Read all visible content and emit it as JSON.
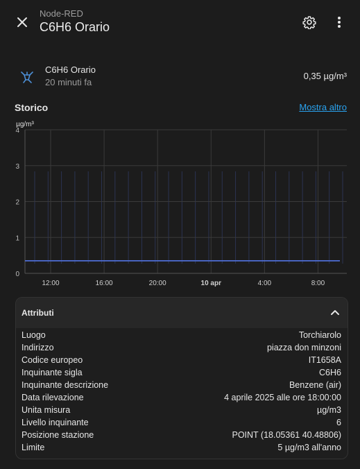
{
  "header": {
    "subtitle": "Node-RED",
    "title": "C6H6 Orario"
  },
  "entity": {
    "name": "C6H6 Orario",
    "last_changed": "20 minuti fa",
    "state": "0,35 µg/m³",
    "icon": "molecule-icon"
  },
  "history": {
    "title": "Storico",
    "show_more": "Mostra altro"
  },
  "chart_data": {
    "type": "line",
    "ylabel": "µg/m³",
    "ylim": [
      0,
      4
    ],
    "y_ticks": [
      "0",
      "1",
      "2",
      "3",
      "4"
    ],
    "x_ticks": [
      "12:00",
      "16:00",
      "20:00",
      "10 apr",
      "4:00",
      "8:00"
    ],
    "x_ticks_bold": [
      false,
      false,
      false,
      true,
      false,
      false
    ],
    "series": [
      {
        "values": [
          0.35,
          0.35
        ]
      }
    ],
    "grid": true,
    "line_color": "#4e6ed6"
  },
  "attributes": {
    "title": "Attributi",
    "items": [
      {
        "key": "Luogo",
        "value": "Torchiarolo"
      },
      {
        "key": "Indirizzo",
        "value": "piazza don minzoni"
      },
      {
        "key": "Codice europeo",
        "value": "IT1658A"
      },
      {
        "key": "Inquinante sigla",
        "value": "C6H6"
      },
      {
        "key": "Inquinante descrizione",
        "value": "Benzene (air)"
      },
      {
        "key": "Data rilevazione",
        "value": "4 aprile 2025 alle ore 18:00:00"
      },
      {
        "key": "Unita misura",
        "value": "µg/m3"
      },
      {
        "key": "Livello inquinante",
        "value": "6"
      },
      {
        "key": "Posizione stazione",
        "value": "POINT (18.05361 40.48806)"
      },
      {
        "key": "Limite",
        "value": "5 µg/m3 all'anno"
      }
    ]
  }
}
